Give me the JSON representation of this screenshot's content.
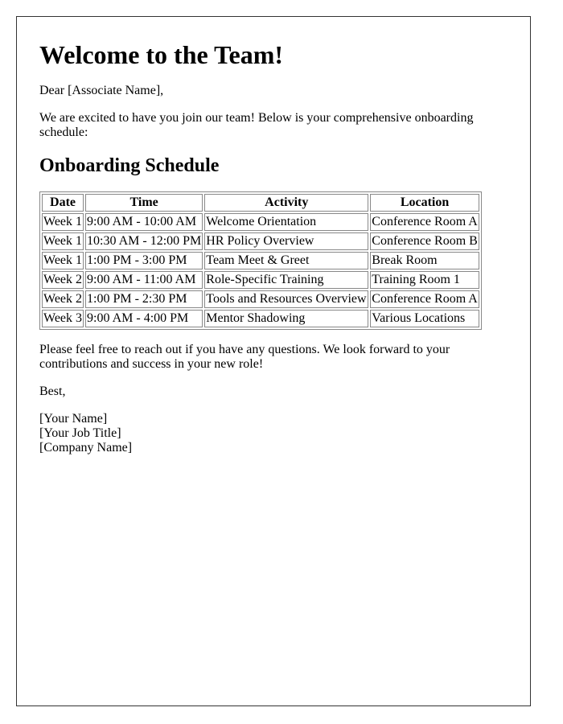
{
  "letter": {
    "title": "Welcome to the Team!",
    "greeting": "Dear [Associate Name],",
    "intro": "We are excited to have you join our team! Below is your comprehensive onboarding schedule:",
    "schedule_heading": "Onboarding Schedule",
    "table": {
      "headers": [
        "Date",
        "Time",
        "Activity",
        "Location"
      ],
      "rows": [
        [
          "Week 1",
          "9:00 AM - 10:00 AM",
          "Welcome Orientation",
          "Conference Room A"
        ],
        [
          "Week 1",
          "10:30 AM - 12:00 PM",
          "HR Policy Overview",
          "Conference Room B"
        ],
        [
          "Week 1",
          "1:00 PM - 3:00 PM",
          "Team Meet & Greet",
          "Break Room"
        ],
        [
          "Week 2",
          "9:00 AM - 11:00 AM",
          "Role-Specific Training",
          "Training Room 1"
        ],
        [
          "Week 2",
          "1:00 PM - 2:30 PM",
          "Tools and Resources Overview",
          "Conference Room A"
        ],
        [
          "Week 3",
          "9:00 AM - 4:00 PM",
          "Mentor Shadowing",
          "Various Locations"
        ]
      ]
    },
    "closing_paragraph": "Please feel free to reach out if you have any questions. We look forward to your contributions and success in your new role!",
    "sign_off": "Best,",
    "signature": {
      "name": "[Your Name]",
      "job_title": "[Your Job Title]",
      "company": "[Company Name]"
    }
  }
}
